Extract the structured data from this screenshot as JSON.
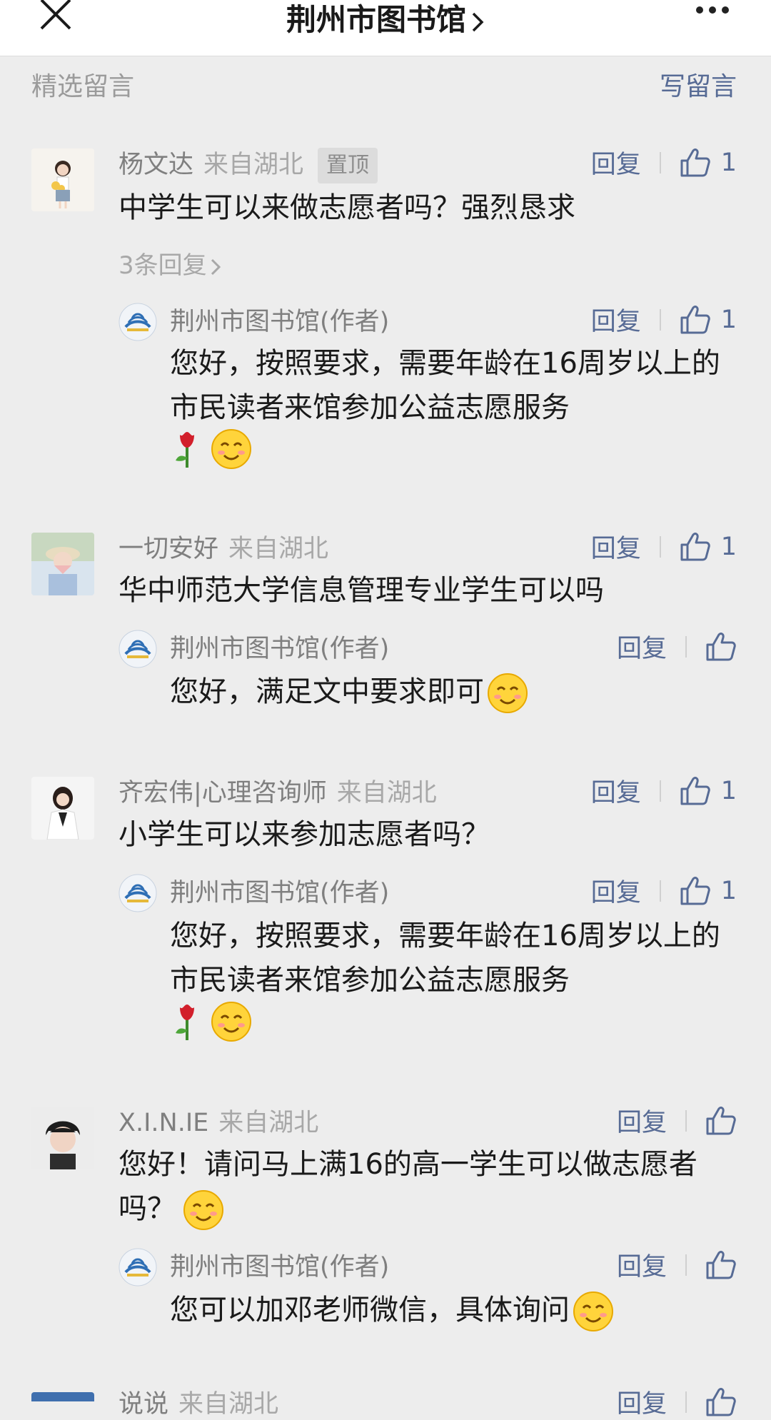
{
  "header": {
    "title": "荆州市图书馆"
  },
  "section": {
    "label": "精选留言",
    "write_label": "写留言"
  },
  "reply_label": "回复",
  "comments": [
    {
      "nickname": "杨文达",
      "location": "来自湖北",
      "pinned_label": "置顶",
      "likes": "1",
      "text": "中学生可以来做志愿者吗？强烈恳求",
      "more_replies": "3条回复",
      "reply": {
        "author": "荆州市图书馆(作者)",
        "likes": "1",
        "text": "您好，按照要求，需要年龄在16周岁以上的市民读者来馆参加公益志愿服务"
      }
    },
    {
      "nickname": "一切安好",
      "location": "来自湖北",
      "likes": "1",
      "text": "华中师范大学信息管理专业学生可以吗",
      "reply": {
        "author": "荆州市图书馆(作者)",
        "likes": "",
        "text": "您好，满足文中要求即可"
      }
    },
    {
      "nickname": "齐宏伟|心理咨询师",
      "location": "来自湖北",
      "likes": "1",
      "text": "小学生可以来参加志愿者吗？",
      "reply": {
        "author": "荆州市图书馆(作者)",
        "likes": "1",
        "text": "您好，按照要求，需要年龄在16周岁以上的市民读者来馆参加公益志愿服务"
      }
    },
    {
      "nickname": "X.I.N.IE",
      "location": "来自湖北",
      "likes": "",
      "text": "您好！请问马上满16的高一学生可以做志愿者吗？",
      "reply": {
        "author": "荆州市图书馆(作者)",
        "likes": "",
        "text": "您可以加邓老师微信，具体询问"
      }
    },
    {
      "nickname": "说说",
      "location": "来自湖北",
      "likes": ""
    }
  ],
  "colors": {
    "link": "#576b95",
    "background": "#ededed",
    "gray_text": "#7f7f7f"
  }
}
